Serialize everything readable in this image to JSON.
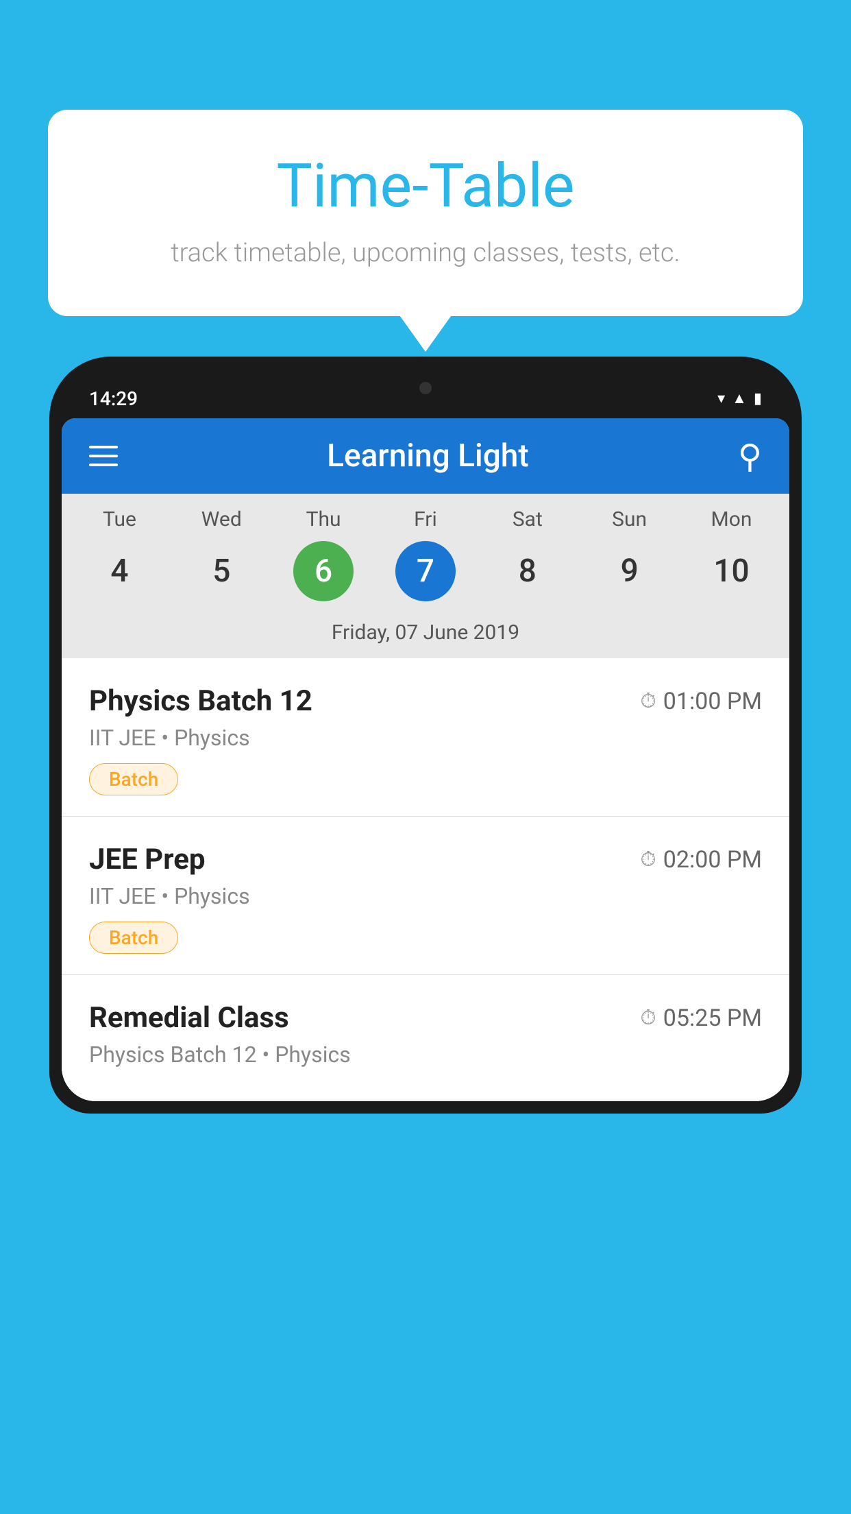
{
  "background_color": "#29B6E8",
  "bubble": {
    "title": "Time-Table",
    "subtitle": "track timetable, upcoming classes, tests, etc."
  },
  "phone": {
    "time": "14:29",
    "app_title": "Learning Light"
  },
  "calendar": {
    "days": [
      {
        "name": "Tue",
        "number": "4",
        "state": "normal"
      },
      {
        "name": "Wed",
        "number": "5",
        "state": "normal"
      },
      {
        "name": "Thu",
        "number": "6",
        "state": "today"
      },
      {
        "name": "Fri",
        "number": "7",
        "state": "selected"
      },
      {
        "name": "Sat",
        "number": "8",
        "state": "normal"
      },
      {
        "name": "Sun",
        "number": "9",
        "state": "normal"
      },
      {
        "name": "Mon",
        "number": "10",
        "state": "normal"
      }
    ],
    "selected_date_label": "Friday, 07 June 2019"
  },
  "schedule": {
    "items": [
      {
        "name": "Physics Batch 12",
        "time": "01:00 PM",
        "sub": "IIT JEE • Physics",
        "badge": "Batch"
      },
      {
        "name": "JEE Prep",
        "time": "02:00 PM",
        "sub": "IIT JEE • Physics",
        "badge": "Batch"
      },
      {
        "name": "Remedial Class",
        "time": "05:25 PM",
        "sub": "Physics Batch 12 • Physics",
        "badge": null
      }
    ]
  },
  "labels": {
    "hamburger": "menu",
    "search": "search",
    "clock": "⏱"
  }
}
